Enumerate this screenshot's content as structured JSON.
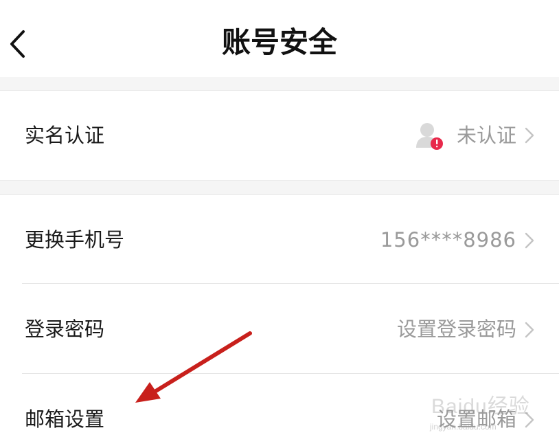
{
  "header": {
    "title": "账号安全",
    "back_icon": "chevron-left-icon"
  },
  "rows": [
    {
      "label": "实名认证",
      "value": "未认证",
      "status_icon": "user-warning-icon",
      "status_color": "#e8294b",
      "chevron": "chevron-right-icon"
    },
    {
      "label": "更换手机号",
      "value": "156****8986",
      "chevron": "chevron-right-icon"
    },
    {
      "label": "登录密码",
      "value": "设置登录密码",
      "chevron": "chevron-right-icon"
    },
    {
      "label": "邮箱设置",
      "value": "设置邮箱",
      "chevron": "chevron-right-icon"
    }
  ],
  "annotation": {
    "arrow_color": "#c8201c"
  },
  "watermark": {
    "text": "Baidu经验",
    "sub": "jingyan.baidu.com"
  }
}
